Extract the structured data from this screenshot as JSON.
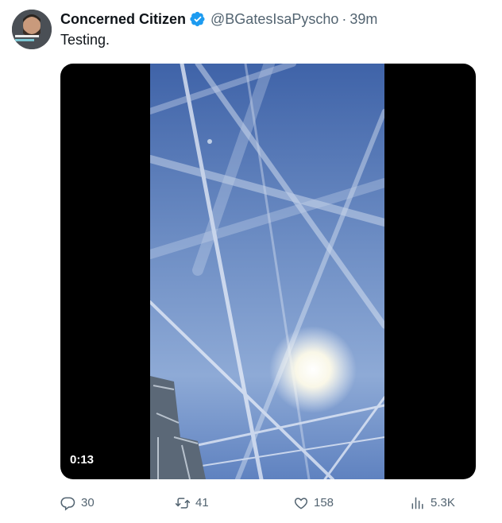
{
  "author": {
    "name": "Concerned Citizen",
    "handle": "@BGatesIsaPyscho",
    "time": "39m",
    "separator": "·"
  },
  "tweet": {
    "text": "Testing."
  },
  "media": {
    "type": "video",
    "duration": "0:13"
  },
  "actions": {
    "replies": "30",
    "retweets": "41",
    "likes": "158",
    "views": "5.3K"
  },
  "colors": {
    "verified": "#1d9bf0",
    "secondary_text": "#536471",
    "primary_text": "#0f1419"
  }
}
